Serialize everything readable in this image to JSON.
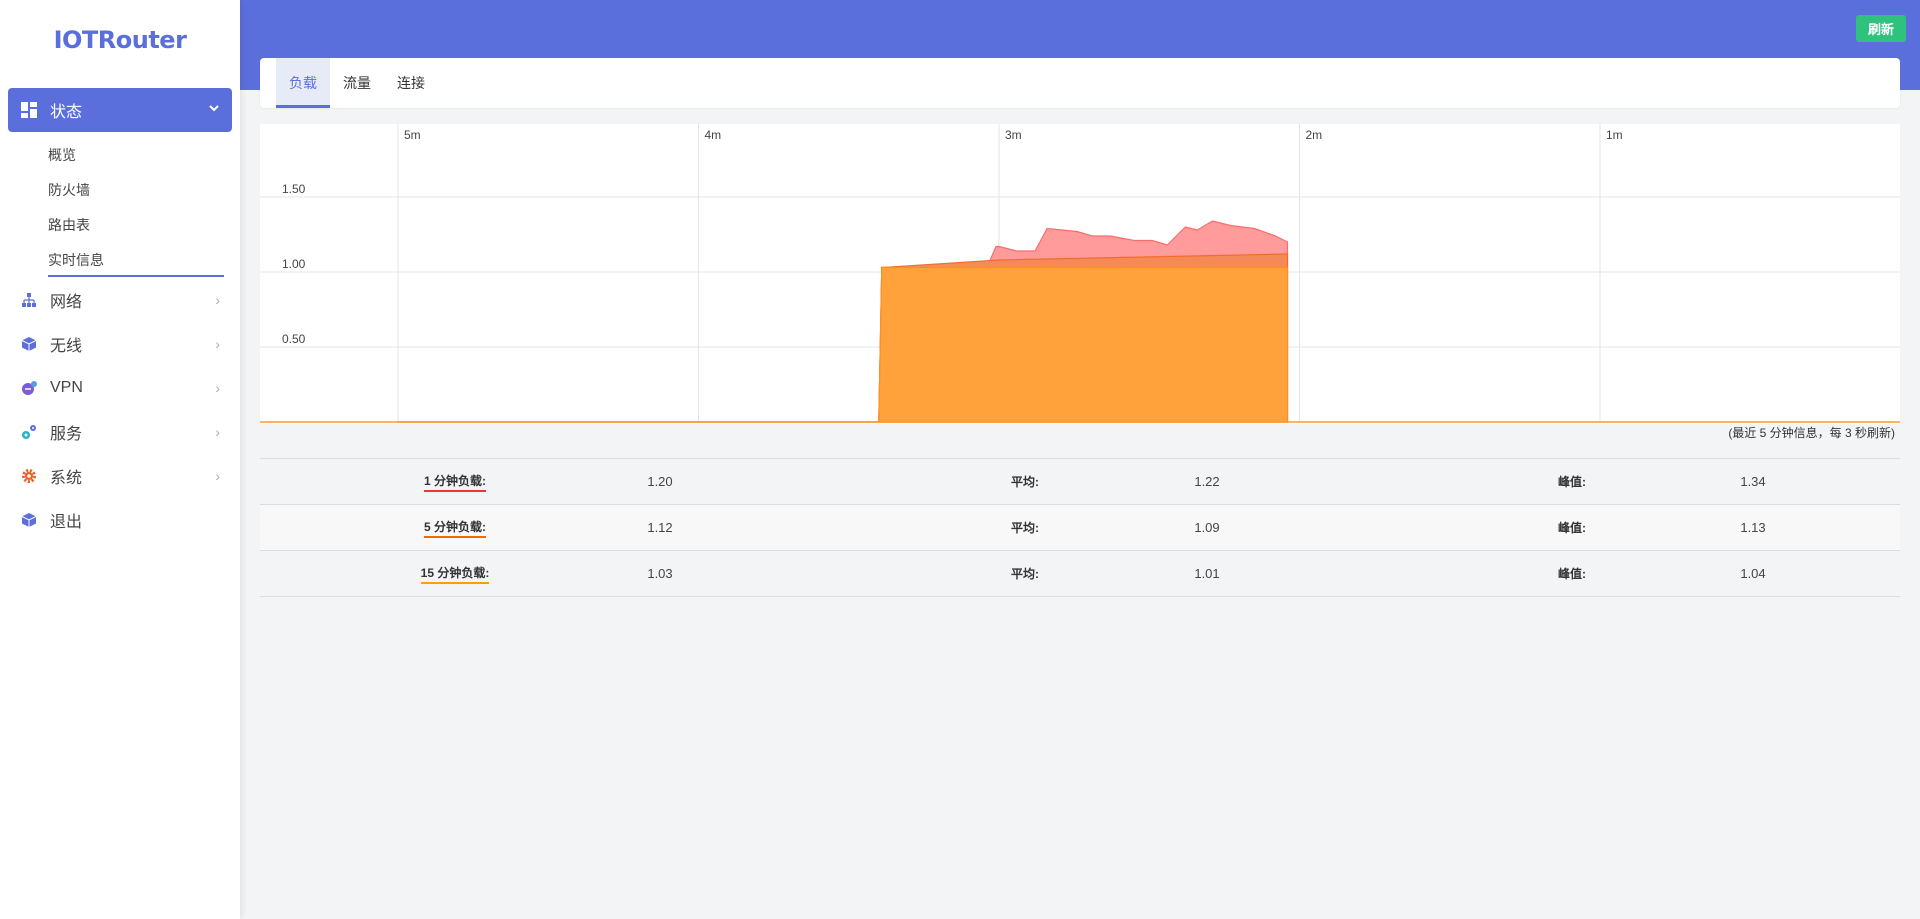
{
  "app": {
    "logo": "IOTRouter"
  },
  "header": {
    "refresh_label": "刷新"
  },
  "sidebar": {
    "status": {
      "label": "状态",
      "items": [
        {
          "label": "概览"
        },
        {
          "label": "防火墙"
        },
        {
          "label": "路由表"
        },
        {
          "label": "实时信息",
          "active": true
        }
      ]
    },
    "items": [
      {
        "label": "网络",
        "icon": "network-icon"
      },
      {
        "label": "无线",
        "icon": "wireless-icon"
      },
      {
        "label": "VPN",
        "icon": "vpn-icon"
      },
      {
        "label": "服务",
        "icon": "services-icon"
      },
      {
        "label": "系统",
        "icon": "system-gear-icon"
      },
      {
        "label": "退出",
        "icon": "logout-icon"
      }
    ]
  },
  "tabs": [
    {
      "label": "负载",
      "active": true
    },
    {
      "label": "流量"
    },
    {
      "label": "连接"
    }
  ],
  "chart_data": {
    "type": "area",
    "x_tick_labels": [
      "5m",
      "4m",
      "3m",
      "2m",
      "1m"
    ],
    "y_tick_labels": [
      "1.50",
      "1.00",
      "0.50"
    ],
    "ylim": [
      0,
      1.5
    ],
    "grid": true,
    "note": "(最近 5 分钟信息，每 3 秒刷新)",
    "series": [
      {
        "name": "1 分钟负载",
        "color": "#ff8a8a",
        "x": [
          0,
          1.6,
          1.61,
          1.72,
          1.96,
          1.99,
          2.0,
          2.06,
          2.12,
          2.16,
          2.26,
          2.31,
          2.37,
          2.45,
          2.51,
          2.56,
          2.62,
          2.66,
          2.71,
          2.77,
          2.85,
          2.92,
          2.96
        ],
        "values": [
          0,
          0,
          1.03,
          1.03,
          1.03,
          1.17,
          1.17,
          1.14,
          1.14,
          1.29,
          1.27,
          1.24,
          1.24,
          1.21,
          1.21,
          1.18,
          1.3,
          1.28,
          1.34,
          1.31,
          1.29,
          1.24,
          1.2
        ]
      },
      {
        "name": "5 分钟负载",
        "color": "#f4874b",
        "x": [
          0,
          1.6,
          1.61,
          2.0,
          2.96
        ],
        "values": [
          0,
          0,
          1.03,
          1.08,
          1.12
        ]
      },
      {
        "name": "15 分钟负载",
        "color": "#ffa033",
        "x": [
          0,
          1.6,
          1.61,
          2.96
        ],
        "values": [
          0,
          0,
          1.03,
          1.03
        ]
      }
    ]
  },
  "stats": {
    "columns": {
      "avg_label": "平均:",
      "peak_label": "峰值:"
    },
    "rows": [
      {
        "label": "1 分钟负载:",
        "current": "1.20",
        "avg": "1.22",
        "peak": "1.34",
        "color": "#e53935"
      },
      {
        "label": "5 分钟负载:",
        "current": "1.12",
        "avg": "1.09",
        "peak": "1.13",
        "color": "#ef6c00"
      },
      {
        "label": "15 分钟负载:",
        "current": "1.03",
        "avg": "1.01",
        "peak": "1.04",
        "color": "#ffa000"
      }
    ]
  }
}
